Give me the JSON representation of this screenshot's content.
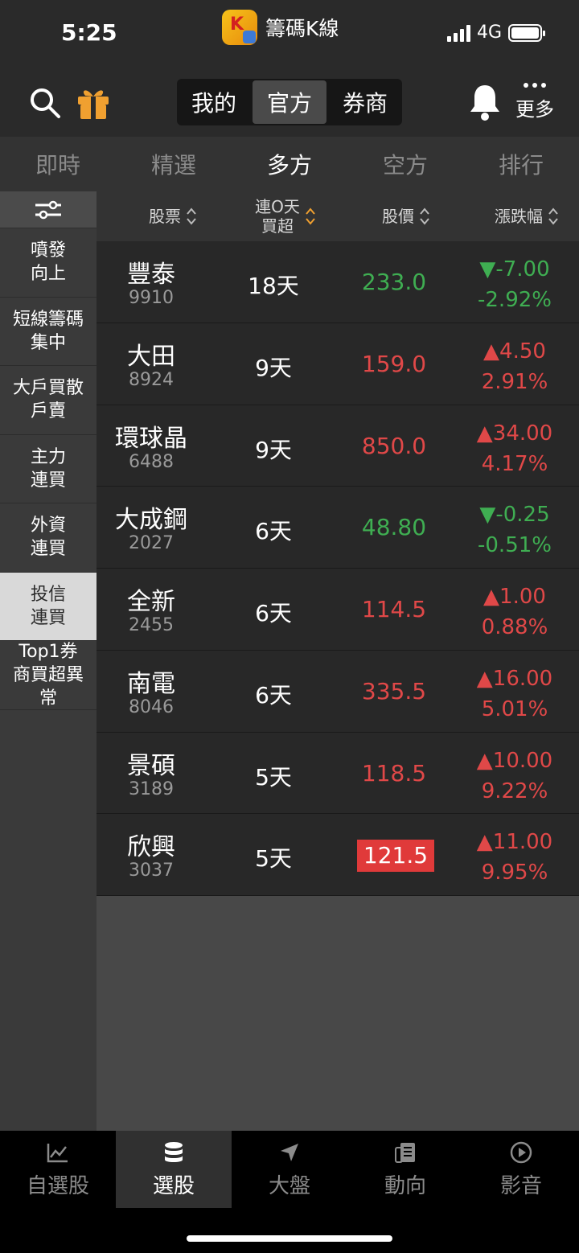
{
  "status_bar": {
    "time": "5:25",
    "app_name": "籌碼K線",
    "network": "4G"
  },
  "header": {
    "segments": [
      "我的",
      "官方",
      "券商"
    ],
    "active_segment": 1,
    "more_label": "更多"
  },
  "tabs": [
    "即時",
    "精選",
    "多方",
    "空方",
    "排行"
  ],
  "active_tab": 2,
  "sidebar": {
    "items": [
      "噴發\n向上",
      "短線籌碼\n集中",
      "大戶買散\n戶賣",
      "主力\n連買",
      "外資\n連買",
      "投信\n連買",
      "Top1券\n商買超異\n常"
    ],
    "active_index": 5
  },
  "table": {
    "headers": {
      "stock": "股票",
      "days": "連O天\n買超",
      "price": "股價",
      "change": "漲跌幅"
    },
    "rows": [
      {
        "name": "豐泰",
        "code": "9910",
        "days": "18天",
        "price": "233.0",
        "change": "▼-7.00",
        "pct": "-2.92%",
        "dir": "down"
      },
      {
        "name": "大田",
        "code": "8924",
        "days": "9天",
        "price": "159.0",
        "change": "▲4.50",
        "pct": "2.91%",
        "dir": "up"
      },
      {
        "name": "環球晶",
        "code": "6488",
        "days": "9天",
        "price": "850.0",
        "change": "▲34.00",
        "pct": "4.17%",
        "dir": "up"
      },
      {
        "name": "大成鋼",
        "code": "2027",
        "days": "6天",
        "price": "48.80",
        "change": "▼-0.25",
        "pct": "-0.51%",
        "dir": "down"
      },
      {
        "name": "全新",
        "code": "2455",
        "days": "6天",
        "price": "114.5",
        "change": "▲1.00",
        "pct": "0.88%",
        "dir": "up"
      },
      {
        "name": "南電",
        "code": "8046",
        "days": "6天",
        "price": "335.5",
        "change": "▲16.00",
        "pct": "5.01%",
        "dir": "up"
      },
      {
        "name": "景碩",
        "code": "3189",
        "days": "5天",
        "price": "118.5",
        "change": "▲10.00",
        "pct": "9.22%",
        "dir": "up"
      },
      {
        "name": "欣興",
        "code": "3037",
        "days": "5天",
        "price": "121.5",
        "change": "▲11.00",
        "pct": "9.95%",
        "dir": "up",
        "limit_up": true
      }
    ]
  },
  "bottom_nav": {
    "items": [
      "自選股",
      "選股",
      "大盤",
      "動向",
      "影音"
    ],
    "active_index": 1
  },
  "colors": {
    "up": "#e04848",
    "down": "#3fae52",
    "accent": "#f0a030"
  }
}
